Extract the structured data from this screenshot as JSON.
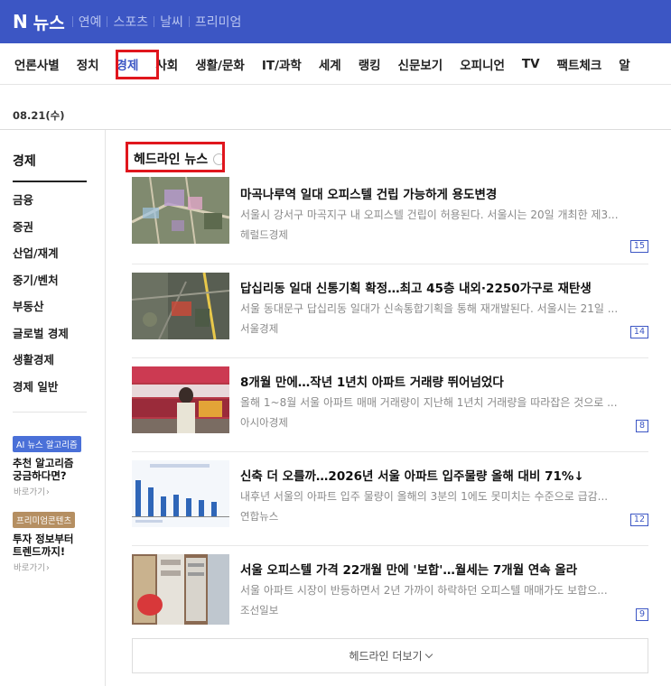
{
  "topbar": {
    "logo_mark": "N",
    "logo_text": "뉴스",
    "nav": [
      "연예",
      "스포츠",
      "날씨",
      "프리미엄"
    ]
  },
  "categories": [
    "언론사별",
    "정치",
    "경제",
    "사회",
    "생활/문화",
    "IT/과학",
    "세계",
    "랭킹",
    "신문보기",
    "오피니언",
    "TV",
    "팩트체크",
    "알"
  ],
  "active_category": "경제",
  "date": "08.21(수)",
  "sidebar": {
    "title": "경제",
    "items": [
      "금융",
      "증권",
      "산업/재계",
      "중기/벤처",
      "부동산",
      "글로벌 경제",
      "생활경제",
      "경제 일반"
    ],
    "promos": [
      {
        "badge": "AI 뉴스 알고리즘",
        "title": "추천 알고리즘\n궁금하다면?",
        "link": "바로가기",
        "arrow": "›"
      },
      {
        "badge": "프리미엄콘텐츠",
        "title": "투자 정보부터\n트렌드까지!",
        "link": "바로가기",
        "arrow": "›"
      }
    ]
  },
  "headline": {
    "title": "헤드라인 뉴스",
    "more": "헤드라인 더보기",
    "articles": [
      {
        "title": "마곡나루역 일대 오피스텔 건립 가능하게 용도변경",
        "desc": "서울시 강서구 마곡지구 내 오피스텔 건립이 허용된다. 서울시는 20일 개최한 제3...",
        "press": "헤럴드경제",
        "count": "15"
      },
      {
        "title": "답십리동 일대 신통기획 확정…최고 45층 내외·2250가구로 재탄생",
        "desc": "서울 동대문구 답십리동 일대가 신속통합기획을 통해 재개발된다. 서울시는 21일 ...",
        "press": "서울경제",
        "count": "14"
      },
      {
        "title": "8개월 만에…작년 1년치 아파트 거래량 뛰어넘었다",
        "desc": "올해 1~8월 서울 아파트 매매 거래량이 지난해 1년치 거래량을 따라잡은 것으로 ...",
        "press": "아시아경제",
        "count": "8"
      },
      {
        "title": "신축 더 오를까…2026년 서울 아파트 입주물량 올해 대비 71%↓",
        "desc": "내후년 서울의 아파트 입주 물량이 올해의 3분의 1에도 못미치는 수준으로 급감...",
        "press": "연합뉴스",
        "count": "12"
      },
      {
        "title": "서울 오피스텔 가격 22개월 만에 '보합'…월세는 7개월 연속 올라",
        "desc": "서울 아파트 시장이 반등하면서 2년 가까이 하락하던 오피스텔 매매가도 보합으...",
        "press": "조선일보",
        "count": "9"
      }
    ]
  },
  "colors": {
    "brand": "#3c56c4",
    "highlight": "#e0161d"
  }
}
